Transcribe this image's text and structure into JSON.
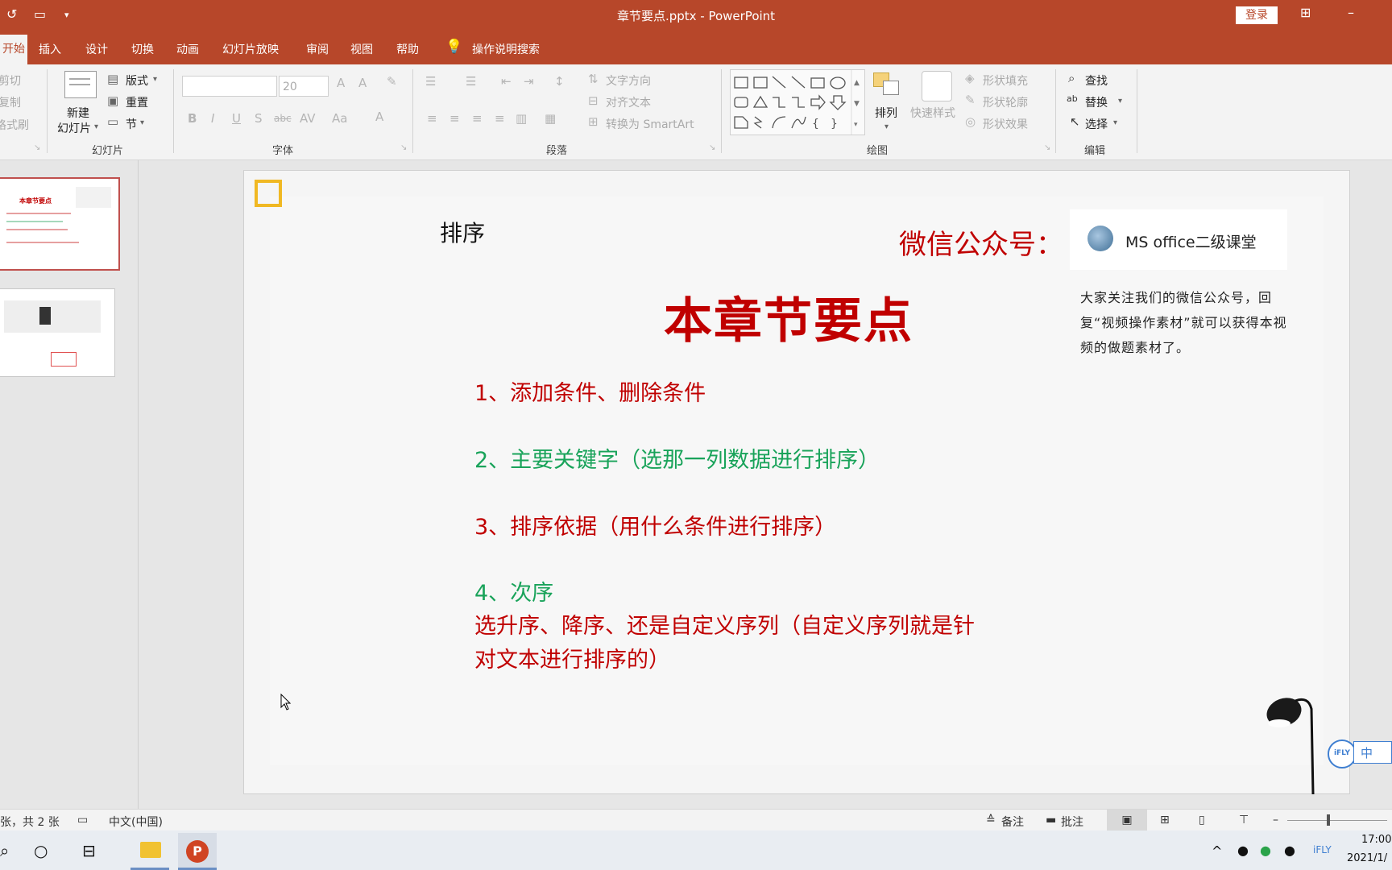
{
  "window": {
    "title": "章节要点.pptx  -  PowerPoint",
    "login_label": "登录"
  },
  "tabs": {
    "home": "开始",
    "items": [
      "插入",
      "设计",
      "切换",
      "动画",
      "幻灯片放映",
      "审阅",
      "视图",
      "帮助"
    ],
    "tell_me": "操作说明搜索"
  },
  "ribbon": {
    "clipboard": {
      "cut": "剪切",
      "copy": "复制",
      "format_painter": "格式刷"
    },
    "slides": {
      "new_slide_line1": "新建",
      "new_slide_line2": "幻灯片",
      "layout": "版式",
      "reset": "重置",
      "section": "节",
      "group_label": "幻灯片"
    },
    "font": {
      "size": "20",
      "group_label": "字体"
    },
    "paragraph": {
      "text_direction": "文字方向",
      "align_text": "对齐文本",
      "convert_smartart": "转换为 SmartArt",
      "group_label": "段落"
    },
    "drawing": {
      "arrange": "排列",
      "quick_styles": "快速样式",
      "shape_fill": "形状填充",
      "shape_outline": "形状轮廓",
      "shape_effects": "形状效果",
      "group_label": "绘图"
    },
    "editing": {
      "find": "查找",
      "replace": "替换",
      "select": "选择",
      "group_label": "编辑"
    }
  },
  "slide": {
    "heading": "排序",
    "wechat_label": "微信公众号：",
    "wechat_name": "MS office二级课堂",
    "wechat_desc": "大家关注我们的微信公众号，回复“视频操作素材”就可以获得本视频的做题素材了。",
    "main_title": "本章节要点",
    "points": [
      "1、添加条件、删除条件",
      "2、主要关键字（选那一列数据进行排序）",
      "3、排序依据（用什么条件进行排序）",
      "4、次序",
      "选升序、降序、还是自定义序列（自定义序列就是针",
      "对文本进行排序的）"
    ],
    "colors": {
      "red": "#c00000",
      "green": "#19a35a"
    }
  },
  "statusbar": {
    "slide_count": "张，共 2 张",
    "language": "中文(中国)",
    "notes": "备注",
    "comments": "批注"
  },
  "ime": {
    "label": "中"
  },
  "taskbar": {
    "time": "17:00",
    "date": "2021/1/"
  }
}
